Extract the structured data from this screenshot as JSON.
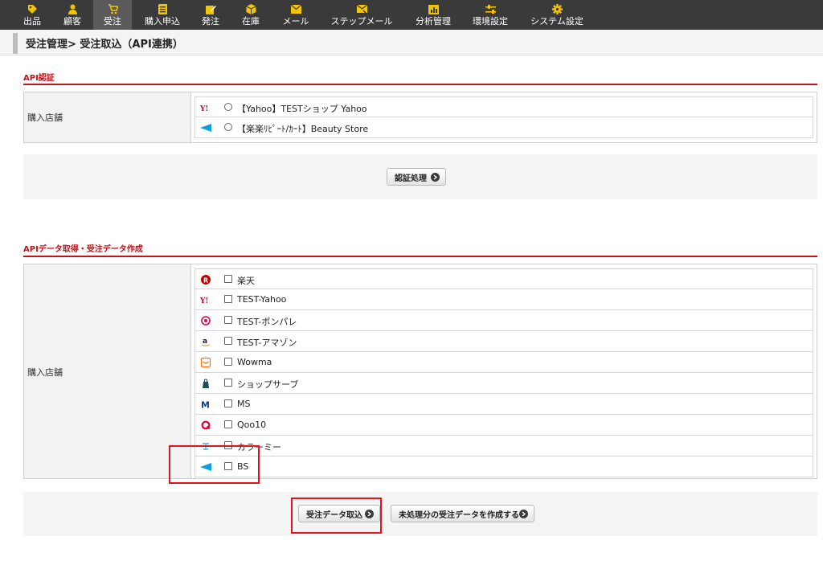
{
  "nav": {
    "items": [
      {
        "label": "出品",
        "icon": "tag-icon"
      },
      {
        "label": "顧客",
        "icon": "person-icon"
      },
      {
        "label": "受注",
        "icon": "cart-icon"
      },
      {
        "label": "購入申込",
        "icon": "list-icon"
      },
      {
        "label": "発注",
        "icon": "edit-icon"
      },
      {
        "label": "在庫",
        "icon": "box-icon"
      },
      {
        "label": "メール",
        "icon": "mail-icon"
      },
      {
        "label": "ステップメール",
        "icon": "step-mail-icon"
      },
      {
        "label": "分析管理",
        "icon": "chart-icon"
      },
      {
        "label": "環境設定",
        "icon": "sliders-icon"
      },
      {
        "label": "システム設定",
        "icon": "gear-icon"
      }
    ],
    "active_label": "受注",
    "icon_color": "#f5c400"
  },
  "page": {
    "title": "受注管理> 受注取込（API連携）"
  },
  "auth_section": {
    "heading": "API認証",
    "field_label": "購入店舗",
    "options": [
      {
        "label": "【Yahoo】TESTショップ Yahoo",
        "logo": "yahoo-logo-icon"
      },
      {
        "label": "【楽楽ﾘﾋﾟｰﾄ/ｶｰﾄ】Beauty Store",
        "logo": "rakuraku-logo-icon"
      }
    ],
    "button_label": "認証処理"
  },
  "fetch_section": {
    "heading": "APIデータ取得・受注データ作成",
    "field_label": "購入店舗",
    "options": [
      {
        "label": "楽天",
        "logo": "rakuten-logo-icon"
      },
      {
        "label": "TEST-Yahoo",
        "logo": "yahoo-logo-icon"
      },
      {
        "label": "TEST-ポンパレ",
        "logo": "ponpare-logo-icon"
      },
      {
        "label": "TEST-アマゾン",
        "logo": "amazon-logo-icon"
      },
      {
        "label": "Wowma",
        "logo": "wowma-logo-icon"
      },
      {
        "label": "ショップサーブ",
        "logo": "shopserve-logo-icon"
      },
      {
        "label": "MS",
        "logo": "makeshop-logo-icon"
      },
      {
        "label": "Qoo10",
        "logo": "qoo10-logo-icon"
      },
      {
        "label": "カラーミー",
        "logo": "colorme-logo-icon"
      },
      {
        "label": "BS",
        "logo": "rakuraku-logo-icon"
      }
    ],
    "import_button_label": "受注データ取込",
    "create_button_label": "未処理分の受注データを作成する"
  },
  "colors": {
    "accent_red": "#c0141b",
    "highlight_red": "#e3141b",
    "nav_bg": "#3a3a3a"
  }
}
